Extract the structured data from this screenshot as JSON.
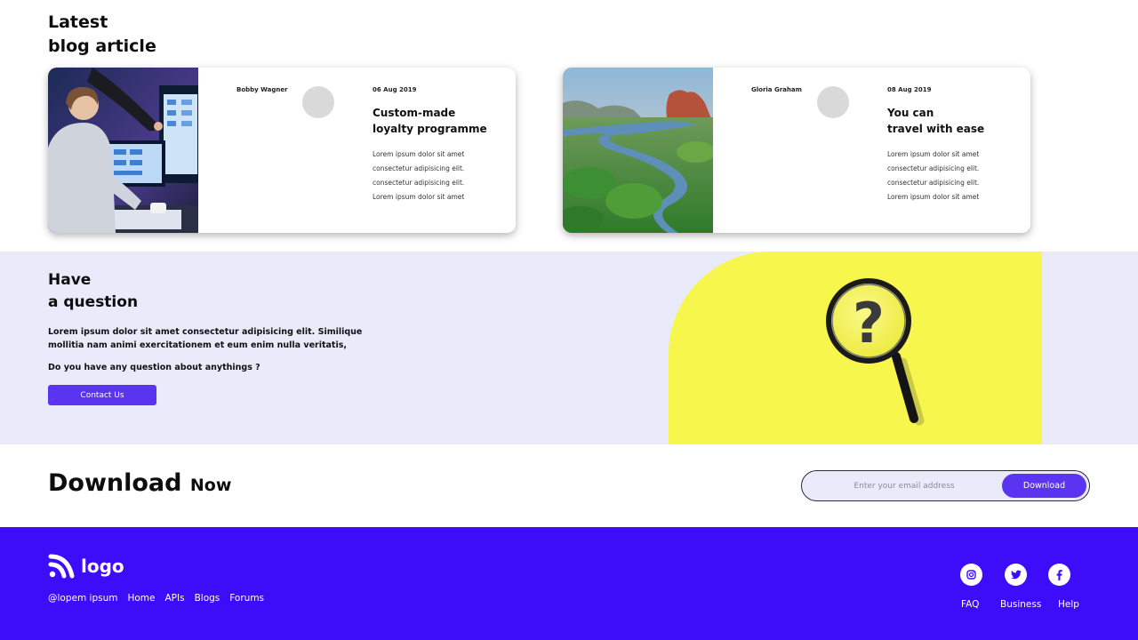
{
  "blog": {
    "heading_line1": "Latest",
    "heading_line2": "blog article",
    "cards": [
      {
        "author": "Bobby Wagner",
        "date": "06 Aug 2019",
        "title_line1": "Custom-made",
        "title_line2": "loyalty programme",
        "body_lines": [
          "Lorem ipsum dolor sit amet",
          "consectetur adipisicing elit.",
          "consectetur adipisicing elit.",
          "Lorem ipsum dolor sit amet"
        ]
      },
      {
        "author": "Gloria Graham",
        "date": "08 Aug 2019",
        "title_line1": "You can",
        "title_line2": "travel with ease",
        "body_lines": [
          "Lorem ipsum dolor sit amet",
          "consectetur adipisicing elit.",
          "consectetur adipisicing elit.",
          "Lorem ipsum dolor sit amet"
        ]
      }
    ]
  },
  "question": {
    "heading_line1": "Have",
    "heading_line2": "a question",
    "text": "Lorem ipsum dolor sit amet consectetur adipisicing elit. Similique mollitia nam animi exercitationem et eum enim nulla veritatis,",
    "ask": "Do you have any question about anythings ?",
    "button_label": "Contact Us"
  },
  "download": {
    "title_big": "Download",
    "title_small": "Now",
    "input_placeholder": "Enter your email address",
    "button_label": "Download"
  },
  "footer": {
    "logo_text": "logo",
    "links": [
      "@lopem ipsum",
      "Home",
      "APIs",
      "Blogs",
      "Forums"
    ],
    "social_icons": [
      "instagram-icon",
      "twitter-icon",
      "facebook-icon"
    ],
    "right_links": [
      "FAQ",
      "Business",
      "Help"
    ]
  },
  "colors": {
    "accent": "#5b34f2",
    "footer_bg": "#3d0cf8",
    "question_bg": "#e9ebfb",
    "question_image_bg": "#f7f64c"
  }
}
